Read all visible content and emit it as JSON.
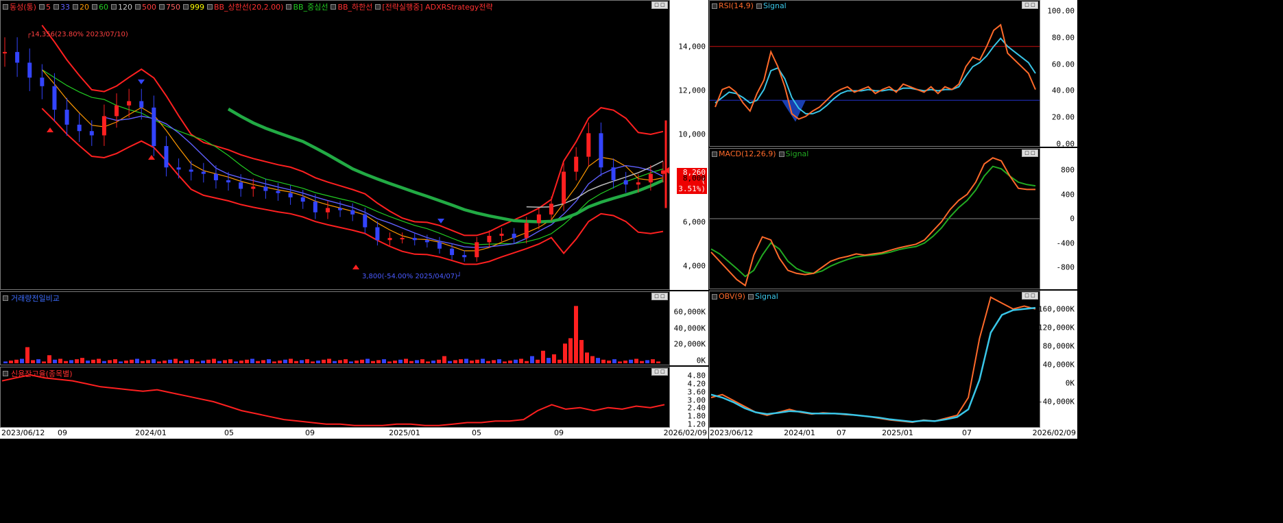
{
  "main_chart": {
    "legend": [
      {
        "label": "동성(통)",
        "color": "#ff3030"
      },
      {
        "label": "5",
        "color": "#ff4040"
      },
      {
        "label": "33",
        "color": "#6060ff"
      },
      {
        "label": "20",
        "color": "#ff9900"
      },
      {
        "label": "60",
        "color": "#22cc22"
      },
      {
        "label": "120",
        "color": "#cccccc"
      },
      {
        "label": "500",
        "color": "#ff4040"
      },
      {
        "label": "750",
        "color": "#ff6060"
      },
      {
        "label": "999",
        "color": "#ffff00"
      },
      {
        "label": "BB_상한선(20,2.00)",
        "color": "#ff3030"
      },
      {
        "label": "BB_중심선",
        "color": "#22cc22"
      },
      {
        "label": "BB_하한선",
        "color": "#ff3030"
      },
      {
        "label": "[전략실행중] ADXRStrategy전략",
        "color": "#ff3030"
      }
    ],
    "y_ticks": [
      "14,000",
      "12,000",
      "10,000",
      "8,000",
      "6,000",
      "4,000"
    ],
    "high_annotation": "14,356(23.80% 2023/07/10)",
    "low_annotation": "3,800(-54.00% 2025/04/07)",
    "current_price": "8,260",
    "current_change": "( 3.51%)",
    "chart_data": {
      "type": "candlestick",
      "xlim": [
        "2023/06/12",
        "2026/02/09"
      ],
      "ylim": [
        3000,
        16000
      ],
      "high": {
        "value": 14356,
        "date": "2023/07/10"
      },
      "low": {
        "value": 3800,
        "date": "2025/04/07"
      },
      "last": {
        "value": 8260,
        "change_pct": 3.51
      },
      "close_series": [
        13800,
        13300,
        12600,
        12200,
        11100,
        10400,
        10100,
        9900,
        10800,
        11300,
        11500,
        11200,
        9400,
        8400,
        8300,
        8200,
        8100,
        7800,
        7700,
        7400,
        7500,
        7300,
        7200,
        7000,
        6800,
        6300,
        6500,
        6400,
        6200,
        5600,
        5000,
        5100,
        5100,
        5000,
        4900,
        4600,
        4300,
        4200,
        4900,
        5200,
        5300,
        5100,
        5800,
        6200,
        6700,
        8200,
        8900,
        10000,
        8400,
        7800,
        7600,
        7700,
        8100,
        8260
      ]
    }
  },
  "volume_panel": {
    "title": "거래량전일비교",
    "y_ticks": [
      "60,000K",
      "40,000K",
      "20,000K",
      "0K"
    ],
    "chart_data": {
      "type": "bar",
      "ylim": [
        0,
        75000
      ],
      "unit": "K",
      "peak": 64000
    }
  },
  "credit_panel": {
    "title": "신용잔고율(종목별)",
    "y_ticks": [
      "4.80",
      "4.20",
      "3.60",
      "3.00",
      "2.40",
      "1.80",
      "1.20"
    ],
    "chart_data": {
      "type": "line",
      "ylim": [
        1.1,
        5.1
      ],
      "values": [
        4.2,
        4.4,
        4.6,
        4.4,
        4.3,
        4.2,
        4.0,
        3.8,
        3.7,
        3.6,
        3.5,
        3.6,
        3.4,
        3.2,
        3.0,
        2.8,
        2.5,
        2.2,
        2.0,
        1.8,
        1.6,
        1.5,
        1.4,
        1.3,
        1.3,
        1.2,
        1.2,
        1.2,
        1.3,
        1.3,
        1.2,
        1.2,
        1.3,
        1.4,
        1.4,
        1.5,
        1.5,
        1.6,
        2.2,
        2.6,
        2.3,
        2.4,
        2.2,
        2.4,
        2.3,
        2.5,
        2.4,
        2.6
      ]
    }
  },
  "x_axis_left": {
    "ticks": [
      "2023/06/12",
      "09",
      "2024/01",
      "05",
      "09",
      "2025/01",
      "05",
      "09",
      "2026/02/09"
    ]
  },
  "rsi_panel": {
    "legend": [
      {
        "label": "RSI(14,9)",
        "color": "#ff6a2a"
      },
      {
        "label": "Signal",
        "color": "#39c6e8"
      }
    ],
    "y_ticks": [
      "100.00",
      "80.00",
      "60.00",
      "40.00",
      "20.00",
      "0.00"
    ],
    "chart_data": {
      "type": "line",
      "ylim": [
        0,
        100
      ],
      "upper": 70,
      "lower": 30,
      "series": [
        {
          "values": [
            25,
            38,
            40,
            36,
            28,
            22,
            35,
            45,
            66,
            55,
            40,
            20,
            16,
            18,
            22,
            25,
            30,
            35,
            38,
            40,
            36,
            38,
            40,
            35,
            38,
            40,
            36,
            42,
            40,
            38,
            36,
            40,
            35,
            40,
            38,
            42,
            55,
            62,
            60,
            70,
            82,
            86,
            65,
            60,
            55,
            50,
            38
          ]
        },
        {
          "values": [
            28,
            32,
            36,
            35,
            32,
            28,
            30,
            38,
            52,
            54,
            46,
            32,
            24,
            20,
            20,
            22,
            26,
            31,
            35,
            37,
            37,
            37,
            38,
            37,
            37,
            38,
            37,
            39,
            39,
            38,
            37,
            38,
            37,
            38,
            38,
            40,
            48,
            55,
            58,
            63,
            70,
            76,
            70,
            66,
            62,
            58,
            50
          ]
        }
      ]
    }
  },
  "macd_panel": {
    "legend": [
      {
        "label": "MACD(12,26,9)",
        "color": "#ff6a2a"
      },
      {
        "label": "Signal",
        "color": "#22aa22"
      }
    ],
    "y_ticks": [
      "800",
      "400",
      "0",
      "-400",
      "-800"
    ],
    "chart_data": {
      "type": "line",
      "ylim": [
        -1150,
        1150
      ],
      "series": [
        {
          "values": [
            -550,
            -700,
            -850,
            -1000,
            -1100,
            -600,
            -300,
            -350,
            -650,
            -850,
            -900,
            -920,
            -900,
            -800,
            -700,
            -650,
            -620,
            -580,
            -600,
            -580,
            -560,
            -520,
            -480,
            -450,
            -420,
            -350,
            -200,
            -50,
            150,
            300,
            400,
            600,
            900,
            1000,
            950,
            700,
            500,
            480,
            480
          ]
        },
        {
          "values": [
            -500,
            -580,
            -700,
            -820,
            -950,
            -850,
            -600,
            -400,
            -500,
            -700,
            -820,
            -880,
            -900,
            -860,
            -780,
            -720,
            -670,
            -630,
            -610,
            -600,
            -580,
            -550,
            -510,
            -480,
            -460,
            -400,
            -290,
            -150,
            30,
            180,
            300,
            470,
            700,
            860,
            820,
            700,
            600,
            560,
            540
          ]
        }
      ]
    }
  },
  "obv_panel": {
    "legend": [
      {
        "label": "OBV(9)",
        "color": "#ff6a2a"
      },
      {
        "label": "Signal",
        "color": "#39c6e8"
      }
    ],
    "y_ticks": [
      "160,000K",
      "120,000K",
      "80,000K",
      "40,000K",
      "0K",
      "-40,000K"
    ],
    "chart_data": {
      "type": "line",
      "ylim": [
        -50000,
        180000
      ],
      "unit": "K",
      "series": [
        {
          "values": [
            0,
            5000,
            -5000,
            -15000,
            -25000,
            -30000,
            -25000,
            -20000,
            -25000,
            -28000,
            -26000,
            -27000,
            -29000,
            -30000,
            -32000,
            -35000,
            -38000,
            -40000,
            -42000,
            -38000,
            -40000,
            -35000,
            -30000,
            0,
            100000,
            170000,
            160000,
            150000,
            155000,
            150000
          ]
        },
        {
          "values": [
            5000,
            0,
            -8000,
            -18000,
            -25000,
            -28000,
            -26000,
            -23000,
            -24000,
            -27000,
            -27000,
            -27000,
            -28000,
            -30000,
            -32000,
            -34000,
            -37000,
            -39000,
            -41000,
            -39000,
            -40000,
            -37000,
            -33000,
            -20000,
            30000,
            110000,
            140000,
            148000,
            150000,
            152000
          ]
        }
      ]
    }
  },
  "x_axis_right": {
    "ticks": [
      "2023/06/12",
      "2024/01",
      "07",
      "2025/01",
      "07",
      "2026/02/09"
    ]
  },
  "window_button": {
    "label": "□ □"
  }
}
